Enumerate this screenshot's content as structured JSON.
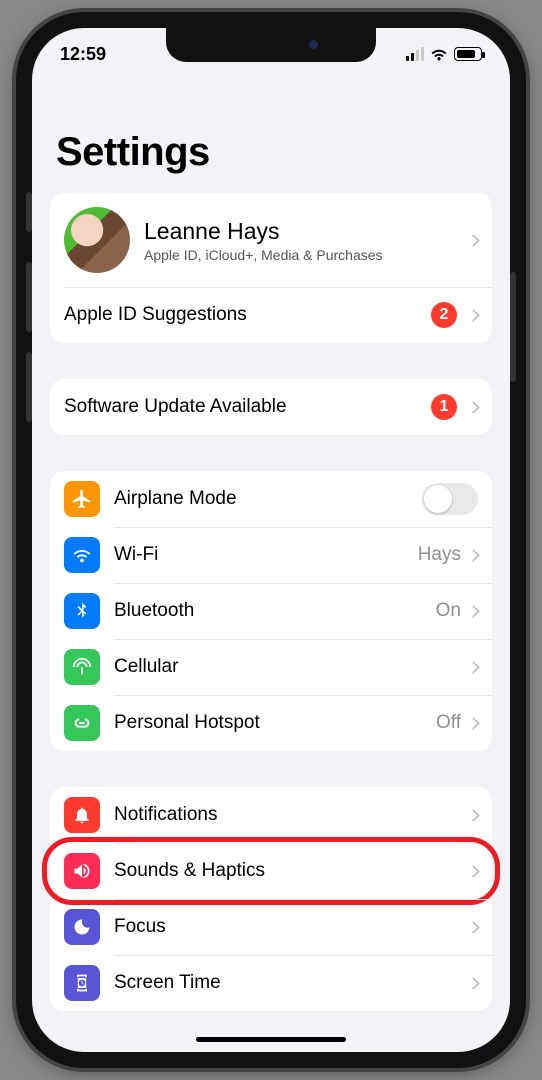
{
  "status": {
    "time": "12:59"
  },
  "page": {
    "title": "Settings",
    "profile": {
      "name": "Leanne Hays",
      "subtitle": "Apple ID, iCloud+, Media & Purchases"
    },
    "apple_id_suggestions": {
      "label": "Apple ID Suggestions",
      "badge": "2"
    },
    "software_update": {
      "label": "Software Update Available",
      "badge": "1"
    },
    "connectivity": {
      "airplane": {
        "label": "Airplane Mode",
        "on": false
      },
      "wifi": {
        "label": "Wi-Fi",
        "value": "Hays"
      },
      "bluetooth": {
        "label": "Bluetooth",
        "value": "On"
      },
      "cellular": {
        "label": "Cellular"
      },
      "hotspot": {
        "label": "Personal Hotspot",
        "value": "Off"
      }
    },
    "system": {
      "notifications": {
        "label": "Notifications"
      },
      "sounds": {
        "label": "Sounds & Haptics",
        "highlighted": true
      },
      "focus": {
        "label": "Focus"
      },
      "screen_time": {
        "label": "Screen Time"
      }
    }
  },
  "colors": {
    "airplane": "#ff9500",
    "wifi": "#007aff",
    "bluetooth": "#007aff",
    "cellular": "#34c759",
    "hotspot": "#34c759",
    "notifications": "#ff3b30",
    "sounds": "#ff2d55",
    "focus": "#5856d6",
    "screen_time": "#5856d6",
    "badge": "#ff3b30",
    "highlight": "#ed1c24"
  }
}
